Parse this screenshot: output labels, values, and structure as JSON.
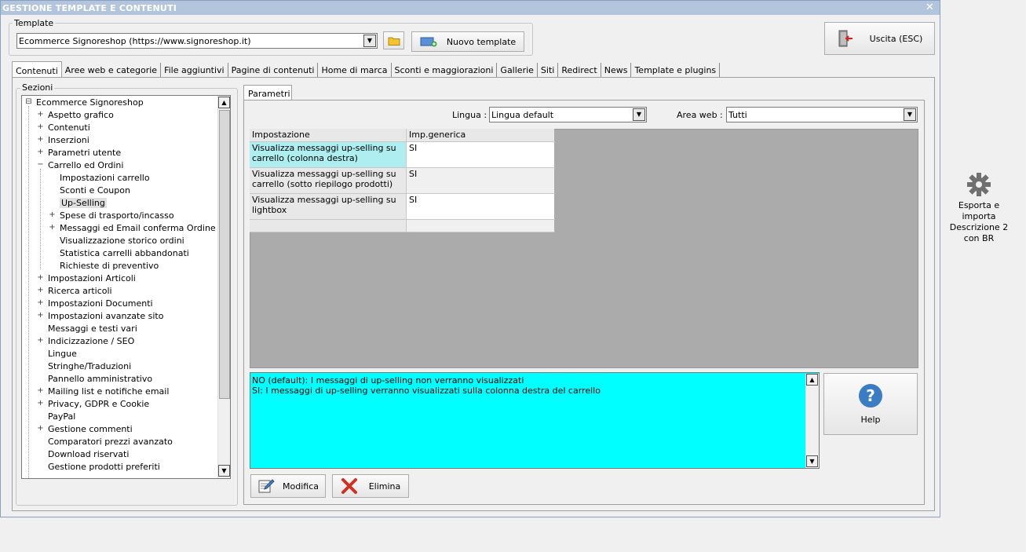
{
  "window": {
    "title": "GESTIONE TEMPLATE E CONTENUTI",
    "close": "✕"
  },
  "template_group": {
    "label": "Template",
    "value": "Ecommerce Signoreshop (https://www.signoreshop.it)",
    "new_button": "Nuovo template"
  },
  "exit_button": "Uscita (ESC)",
  "tabs": [
    "Contenuti",
    "Aree web e categorie",
    "File aggiuntivi",
    "Pagine di contenuti",
    "Home di marca",
    "Sconti e maggiorazioni",
    "Gallerie",
    "Siti",
    "Redirect",
    "News",
    "Template e plugins"
  ],
  "sections": {
    "label": "Sezioni",
    "tree": [
      {
        "label": "Ecommerce Signoreshop",
        "level": 0,
        "expander": "⊟"
      },
      {
        "label": "Aspetto grafico",
        "level": 1,
        "expander": "+"
      },
      {
        "label": "Contenuti",
        "level": 1,
        "expander": "+"
      },
      {
        "label": "Inserzioni",
        "level": 1,
        "expander": "+"
      },
      {
        "label": "Parametri utente",
        "level": 1,
        "expander": "+"
      },
      {
        "label": "Carrello ed Ordini",
        "level": 1,
        "expander": "−"
      },
      {
        "label": "Impostazioni carrello",
        "level": 2,
        "expander": ""
      },
      {
        "label": "Sconti e Coupon",
        "level": 2,
        "expander": ""
      },
      {
        "label": "Up-Selling",
        "level": 2,
        "expander": "",
        "selected": true
      },
      {
        "label": "Spese di trasporto/incasso",
        "level": 2,
        "expander": "+"
      },
      {
        "label": "Messaggi ed Email conferma Ordine",
        "level": 2,
        "expander": "+"
      },
      {
        "label": "Visualizzazione storico ordini",
        "level": 2,
        "expander": ""
      },
      {
        "label": "Statistica carrelli abbandonati",
        "level": 2,
        "expander": ""
      },
      {
        "label": "Richieste di preventivo",
        "level": 2,
        "expander": ""
      },
      {
        "label": "Impostazioni Articoli",
        "level": 1,
        "expander": "+"
      },
      {
        "label": "Ricerca articoli",
        "level": 1,
        "expander": "+"
      },
      {
        "label": "Impostazioni Documenti",
        "level": 1,
        "expander": "+"
      },
      {
        "label": "Impostazioni avanzate sito",
        "level": 1,
        "expander": "+"
      },
      {
        "label": "Messaggi e testi vari",
        "level": 1,
        "expander": ""
      },
      {
        "label": "Indicizzazione / SEO",
        "level": 1,
        "expander": "+"
      },
      {
        "label": "Lingue",
        "level": 1,
        "expander": ""
      },
      {
        "label": "Stringhe/Traduzioni",
        "level": 1,
        "expander": ""
      },
      {
        "label": "Pannello amministrativo",
        "level": 1,
        "expander": ""
      },
      {
        "label": "Mailing list e notifiche email",
        "level": 1,
        "expander": "+"
      },
      {
        "label": "Privacy, GDPR e Cookie",
        "level": 1,
        "expander": "+"
      },
      {
        "label": "PayPal",
        "level": 1,
        "expander": ""
      },
      {
        "label": "Gestione commenti",
        "level": 1,
        "expander": "+"
      },
      {
        "label": "Comparatori prezzi avanzato",
        "level": 1,
        "expander": ""
      },
      {
        "label": "Download riservati",
        "level": 1,
        "expander": ""
      },
      {
        "label": "Gestione prodotti preferiti",
        "level": 1,
        "expander": ""
      }
    ]
  },
  "params": {
    "tab": "Parametri",
    "lingua_label": "Lingua :",
    "lingua_value": "Lingua default",
    "area_label": "Area web :",
    "area_value": "Tutti",
    "grid": {
      "headers": [
        "Impostazione",
        "Imp.generica"
      ],
      "rows": [
        {
          "setting": "Visualizza messaggi up-selling su carrello (colonna destra)",
          "value": "SI"
        },
        {
          "setting": "Visualizza messaggi up-selling su carrello (sotto riepilogo prodotti)",
          "value": "SI"
        },
        {
          "setting": "Visualizza messaggi up-selling su lightbox",
          "value": "SI"
        }
      ]
    },
    "description": [
      "NO (default): I messaggi di up-selling non verranno visualizzati",
      "SI: I messaggi di up-selling verranno visualizzati sulla colonna destra del carrello"
    ],
    "help_button": "Help",
    "modify_button": "Modifica",
    "delete_button": "Elimina"
  },
  "side": {
    "export_label": "Esporta e importa Descrizione 2 con BR"
  }
}
